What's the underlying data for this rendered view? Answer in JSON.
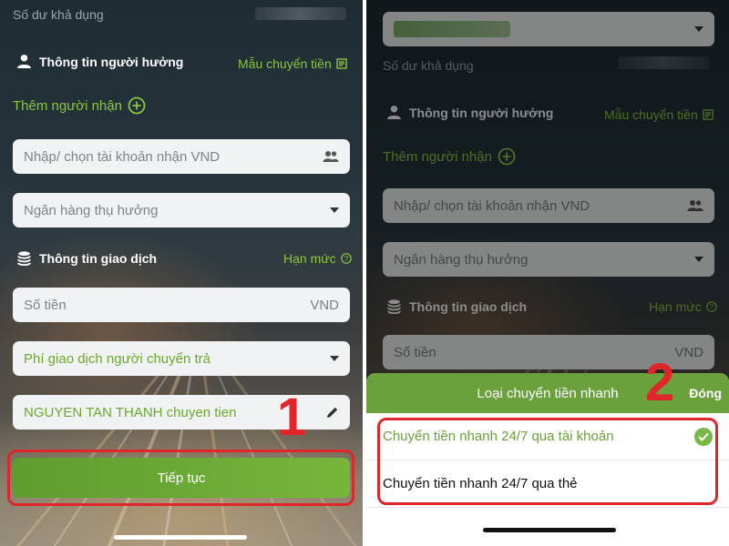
{
  "left": {
    "balance_label": "Số dư khả dụng",
    "recipient_info": {
      "title": "Thông tin người hưởng",
      "template_link": "Mẫu chuyển tiền"
    },
    "add_recipient": "Thêm người nhận",
    "account_input": {
      "placeholder": "Nhập/ chọn tài khoản nhận VND"
    },
    "bank_select": {
      "placeholder": "Ngân hàng thụ hưởng"
    },
    "transaction_info": {
      "title": "Thông tin giao dịch",
      "limit_link": "Hạn mức"
    },
    "amount_input": {
      "placeholder": "Số tiền",
      "currency": "VND"
    },
    "fee_select": {
      "value": "Phí giao dịch người chuyển trả"
    },
    "content_input": {
      "value": "NGUYEN TAN THANH chuyen tien"
    },
    "continue_button": "Tiếp tục",
    "step_marker": "1"
  },
  "right": {
    "balance_label": "Số dư khả dụng",
    "recipient_info": {
      "title": "Thông tin người hưởng",
      "template_link": "Mẫu chuyển tiền"
    },
    "add_recipient": "Thêm người nhận",
    "account_input": {
      "placeholder": "Nhập/ chọn tài khoản nhận VND"
    },
    "bank_select": {
      "placeholder": "Ngân hàng thụ hưởng"
    },
    "transaction_info": {
      "title": "Thông tin giao dịch",
      "limit_link": "Hạn mức"
    },
    "amount_input": {
      "placeholder": "Số tiền",
      "currency": "VND"
    },
    "step_marker": "2",
    "sheet": {
      "title": "Loại chuyển tiền nhanh",
      "close": "Đóng",
      "options": [
        {
          "label": "Chuyển tiền nhanh 24/7 qua tài khoản",
          "selected": true
        },
        {
          "label": "Chuyển tiền nhanh 24/7 qua thẻ",
          "selected": false
        }
      ]
    }
  },
  "colors": {
    "accent_green": "#8cc63f",
    "button_green": "#6aa13c",
    "annotation_red": "#e0262b"
  }
}
